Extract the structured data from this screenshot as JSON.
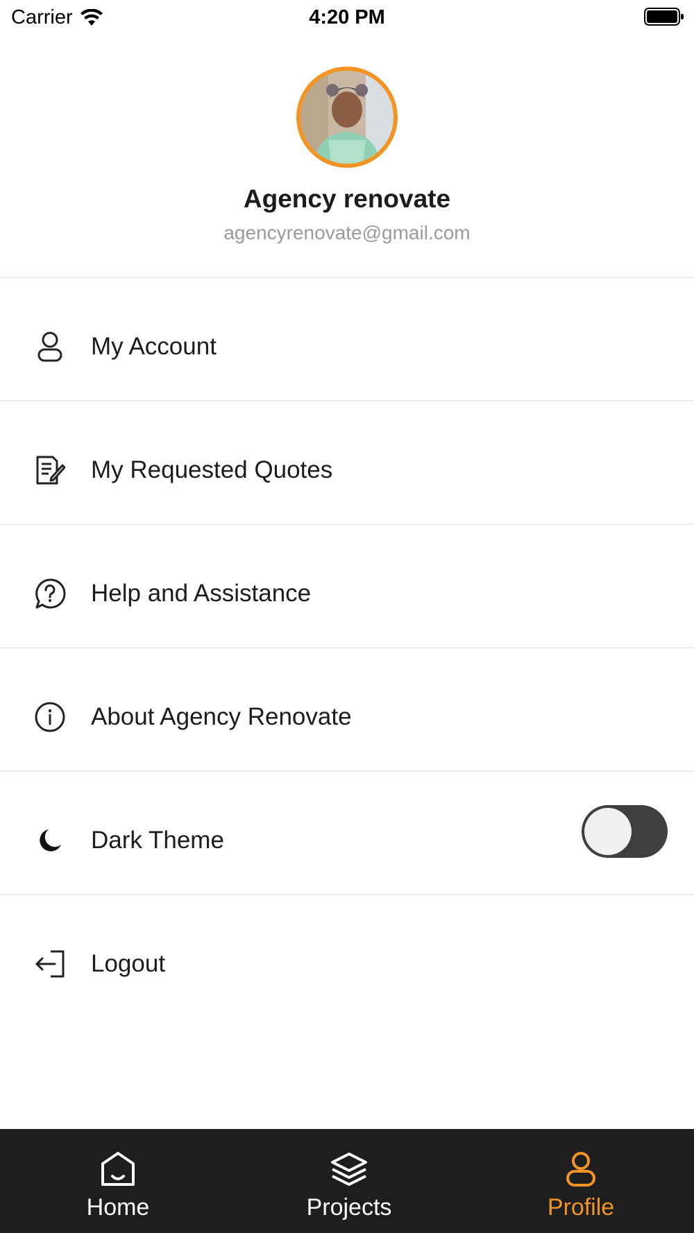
{
  "status_bar": {
    "carrier": "Carrier",
    "time": "4:20 PM"
  },
  "profile": {
    "name": "Agency renovate",
    "email": "agencyrenovate@gmail.com",
    "avatar_ring_color": "#f29424"
  },
  "menu": {
    "items": [
      {
        "label": "My Account",
        "icon": "user-icon"
      },
      {
        "label": "My Requested Quotes",
        "icon": "document-edit-icon"
      },
      {
        "label": "Help and Assistance",
        "icon": "help-bubble-icon"
      },
      {
        "label": "About Agency Renovate",
        "icon": "info-icon"
      },
      {
        "label": "Dark Theme",
        "icon": "moon-icon",
        "toggle": false
      },
      {
        "label": "Logout",
        "icon": "logout-icon"
      }
    ]
  },
  "bottom_nav": {
    "items": [
      {
        "label": "Home",
        "icon": "home-icon",
        "active": false
      },
      {
        "label": "Projects",
        "icon": "layers-icon",
        "active": false
      },
      {
        "label": "Profile",
        "icon": "user-icon",
        "active": true
      }
    ],
    "active_color": "#f29424",
    "background": "#1e1e1e"
  }
}
